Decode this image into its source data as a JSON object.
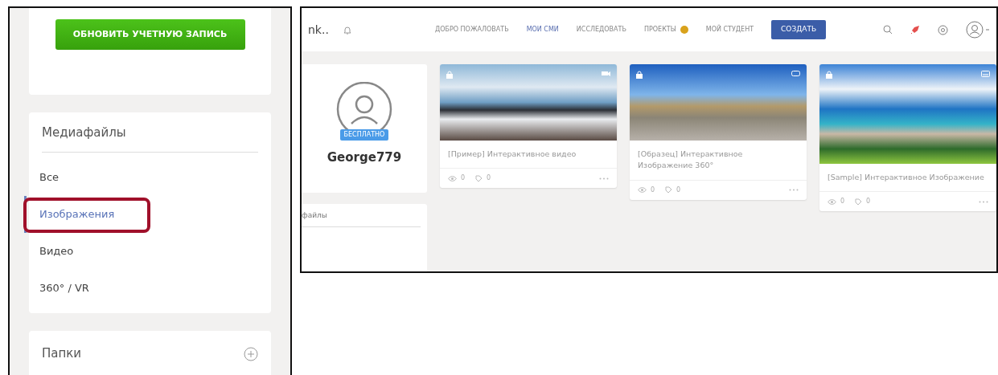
{
  "left_panel": {
    "upgrade_button": "ОБНОВИТЬ УЧЕТНУЮ ЗАПИСЬ",
    "media": {
      "title": "Медиафайлы",
      "items": [
        {
          "label": "Все",
          "selected": false,
          "highlighted": false
        },
        {
          "label": "Изображения",
          "selected": true,
          "highlighted": true
        },
        {
          "label": "Видео",
          "selected": false,
          "highlighted": false
        },
        {
          "label": "360° / VR",
          "selected": false,
          "highlighted": false
        }
      ]
    },
    "folders": {
      "title": "Папки"
    }
  },
  "right_panel": {
    "logo": "nk..",
    "nav": [
      {
        "label": "ДОБРО ПОЖАЛОВАТЬ",
        "selected": false,
        "dot": false
      },
      {
        "label": "МОИ СМИ",
        "selected": true,
        "dot": false
      },
      {
        "label": "ИССЛЕДОВАТЬ",
        "selected": false,
        "dot": false
      },
      {
        "label": "ПРОЕКТЫ",
        "selected": false,
        "dot": true
      },
      {
        "label": "МОЙ СТУДЕНТ",
        "selected": false,
        "dot": false
      }
    ],
    "create_button": "СОЗДАТЬ",
    "profile": {
      "plan": "БЕСПЛАТНО",
      "username": "George779"
    },
    "media_title": "файлы",
    "cards": [
      {
        "kind": "video",
        "title": "[Пример] Интерактивное видео",
        "views": "0",
        "likes": "0"
      },
      {
        "kind": "panorama",
        "title": "[Образец] Интерактивное Изображение 360°",
        "views": "0",
        "likes": "0"
      },
      {
        "kind": "image",
        "title": "[Sample] Интерактивное Изображение",
        "views": "0",
        "likes": "0"
      }
    ]
  }
}
